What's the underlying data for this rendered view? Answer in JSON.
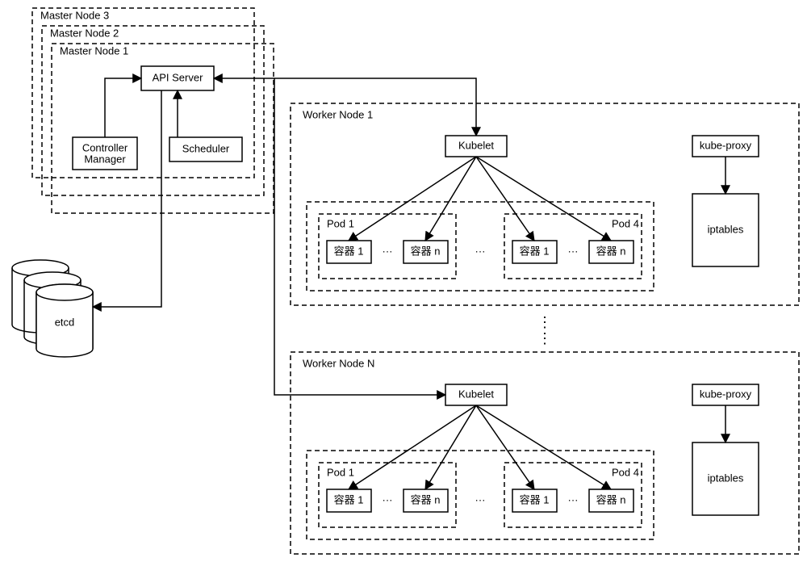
{
  "masters": {
    "m3": "Master Node 3",
    "m2": "Master Node 2",
    "m1": "Master Node 1",
    "api": "API Server",
    "controller": [
      "Controller",
      "Manager"
    ],
    "scheduler": "Scheduler"
  },
  "etcd": "etcd",
  "workers": {
    "w1": {
      "title": "Worker Node 1",
      "kubelet": "Kubelet",
      "kubeproxy": "kube-proxy",
      "iptables": "iptables",
      "pod1": "Pod 1",
      "pod4": "Pod 4",
      "c1a": "容器 1",
      "c1n": "容器 n",
      "c4a": "容器 1",
      "c4n": "容器 n"
    },
    "wN": {
      "title": "Worker Node N",
      "kubelet": "Kubelet",
      "kubeproxy": "kube-proxy",
      "iptables": "iptables",
      "pod1": "Pod 1",
      "pod4": "Pod 4",
      "c1a": "容器 1",
      "c1n": "容器 n",
      "c4a": "容器 1",
      "c4n": "容器 n"
    }
  },
  "dots": "···",
  "vdots": "⋮"
}
